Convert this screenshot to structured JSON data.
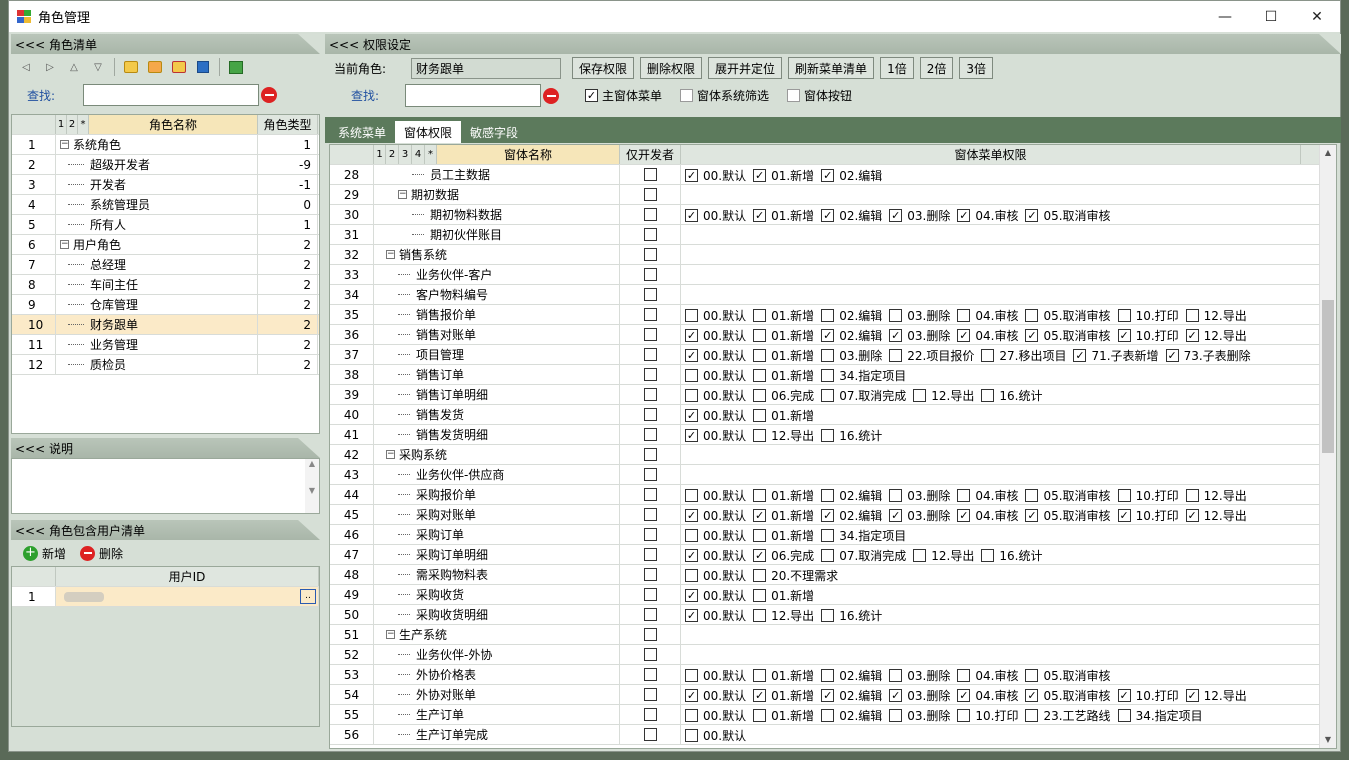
{
  "title": "角色管理",
  "window_buttons": {
    "min": "—",
    "max": "☐",
    "close": "✕"
  },
  "left": {
    "roles_header": "<<< 角色清单",
    "search_label": "查找:",
    "role_cols": {
      "c1": "1",
      "c2": "2",
      "c3": "*",
      "name": "角色名称",
      "type": "角色类型"
    },
    "roles": [
      {
        "no": "1",
        "name": "系统角色",
        "type": "1",
        "level": 0
      },
      {
        "no": "2",
        "name": "超级开发者",
        "type": "-9",
        "level": 1
      },
      {
        "no": "3",
        "name": "开发者",
        "type": "-1",
        "level": 1
      },
      {
        "no": "4",
        "name": "系统管理员",
        "type": "0",
        "level": 1
      },
      {
        "no": "5",
        "name": "所有人",
        "type": "1",
        "level": 1
      },
      {
        "no": "6",
        "name": "用户角色",
        "type": "2",
        "level": 0
      },
      {
        "no": "7",
        "name": "总经理",
        "type": "2",
        "level": 1
      },
      {
        "no": "8",
        "name": "车间主任",
        "type": "2",
        "level": 1
      },
      {
        "no": "9",
        "name": "仓库管理",
        "type": "2",
        "level": 1
      },
      {
        "no": "10",
        "name": "财务跟单",
        "type": "2",
        "level": 1,
        "selected": true
      },
      {
        "no": "11",
        "name": "业务管理",
        "type": "2",
        "level": 1
      },
      {
        "no": "12",
        "name": "质检员",
        "type": "2",
        "level": 1
      }
    ],
    "desc_header": "<<< 说明",
    "users_header": "<<< 角色包含用户清单",
    "add_label": "新增",
    "del_label": "删除",
    "user_col": "用户ID",
    "user_rows": [
      {
        "no": "1",
        "dots": ".."
      }
    ]
  },
  "right": {
    "header": "<<< 权限设定",
    "current_role_label": "当前角色:",
    "current_role": "财务跟单",
    "buttons": [
      "保存权限",
      "删除权限",
      "展开并定位",
      "刷新菜单清单",
      "1倍",
      "2倍",
      "3倍"
    ],
    "search_label": "查找:",
    "opts": [
      {
        "label": "主窗体菜单",
        "checked": true
      },
      {
        "label": "窗体系统筛选",
        "checked": false
      },
      {
        "label": "窗体按钮",
        "checked": false
      }
    ],
    "tabs": [
      "系统菜单",
      "窗体权限",
      "敏感字段"
    ],
    "active_tab": 1,
    "cols": {
      "c1": "1",
      "c2": "2",
      "c3": "3",
      "c4": "4",
      "c5": "*",
      "name": "窗体名称",
      "dev": "仅开发者",
      "perm": "窗体菜单权限"
    },
    "rows": [
      {
        "no": "28",
        "name": "员工主数据",
        "indent": 3,
        "perms": [
          [
            "00.默认",
            1
          ],
          [
            "01.新增",
            1
          ],
          [
            "02.编辑",
            1
          ]
        ]
      },
      {
        "no": "29",
        "name": "期初数据",
        "indent": 2,
        "group": true,
        "perms": []
      },
      {
        "no": "30",
        "name": "期初物料数据",
        "indent": 3,
        "perms": [
          [
            "00.默认",
            1
          ],
          [
            "01.新增",
            1
          ],
          [
            "02.编辑",
            1
          ],
          [
            "03.删除",
            1
          ],
          [
            "04.审核",
            1
          ],
          [
            "05.取消审核",
            1
          ]
        ]
      },
      {
        "no": "31",
        "name": "期初伙伴账目",
        "indent": 3,
        "perms": []
      },
      {
        "no": "32",
        "name": "销售系统",
        "indent": 1,
        "group": true,
        "perms": []
      },
      {
        "no": "33",
        "name": "业务伙伴-客户",
        "indent": 2,
        "perms": []
      },
      {
        "no": "34",
        "name": "客户物料编号",
        "indent": 2,
        "perms": []
      },
      {
        "no": "35",
        "name": "销售报价单",
        "indent": 2,
        "perms": [
          [
            "00.默认",
            0
          ],
          [
            "01.新增",
            0
          ],
          [
            "02.编辑",
            0
          ],
          [
            "03.删除",
            0
          ],
          [
            "04.审核",
            0
          ],
          [
            "05.取消审核",
            0
          ],
          [
            "10.打印",
            0
          ],
          [
            "12.导出",
            0
          ]
        ]
      },
      {
        "no": "36",
        "name": "销售对账单",
        "indent": 2,
        "perms": [
          [
            "00.默认",
            1
          ],
          [
            "01.新增",
            0
          ],
          [
            "02.编辑",
            1
          ],
          [
            "03.删除",
            1
          ],
          [
            "04.审核",
            1
          ],
          [
            "05.取消审核",
            1
          ],
          [
            "10.打印",
            1
          ],
          [
            "12.导出",
            1
          ]
        ]
      },
      {
        "no": "37",
        "name": "项目管理",
        "indent": 2,
        "perms": [
          [
            "00.默认",
            1
          ],
          [
            "01.新增",
            0
          ],
          [
            "03.删除",
            0
          ],
          [
            "22.项目报价",
            0
          ],
          [
            "27.移出项目",
            0
          ],
          [
            "71.子表新增",
            1
          ],
          [
            "73.子表删除",
            1
          ]
        ]
      },
      {
        "no": "38",
        "name": "销售订单",
        "indent": 2,
        "perms": [
          [
            "00.默认",
            0
          ],
          [
            "01.新增",
            0
          ],
          [
            "34.指定项目",
            0
          ]
        ]
      },
      {
        "no": "39",
        "name": "销售订单明细",
        "indent": 2,
        "perms": [
          [
            "00.默认",
            0
          ],
          [
            "06.完成",
            0
          ],
          [
            "07.取消完成",
            0
          ],
          [
            "12.导出",
            0
          ],
          [
            "16.统计",
            0
          ]
        ]
      },
      {
        "no": "40",
        "name": "销售发货",
        "indent": 2,
        "perms": [
          [
            "00.默认",
            1
          ],
          [
            "01.新增",
            0
          ]
        ]
      },
      {
        "no": "41",
        "name": "销售发货明细",
        "indent": 2,
        "perms": [
          [
            "00.默认",
            1
          ],
          [
            "12.导出",
            0
          ],
          [
            "16.统计",
            0
          ]
        ]
      },
      {
        "no": "42",
        "name": "采购系统",
        "indent": 1,
        "group": true,
        "perms": []
      },
      {
        "no": "43",
        "name": "业务伙伴-供应商",
        "indent": 2,
        "perms": []
      },
      {
        "no": "44",
        "name": "采购报价单",
        "indent": 2,
        "perms": [
          [
            "00.默认",
            0
          ],
          [
            "01.新增",
            0
          ],
          [
            "02.编辑",
            0
          ],
          [
            "03.删除",
            0
          ],
          [
            "04.审核",
            0
          ],
          [
            "05.取消审核",
            0
          ],
          [
            "10.打印",
            0
          ],
          [
            "12.导出",
            0
          ]
        ]
      },
      {
        "no": "45",
        "name": "采购对账单",
        "indent": 2,
        "perms": [
          [
            "00.默认",
            1
          ],
          [
            "01.新增",
            1
          ],
          [
            "02.编辑",
            1
          ],
          [
            "03.删除",
            1
          ],
          [
            "04.审核",
            1
          ],
          [
            "05.取消审核",
            1
          ],
          [
            "10.打印",
            1
          ],
          [
            "12.导出",
            1
          ]
        ]
      },
      {
        "no": "46",
        "name": "采购订单",
        "indent": 2,
        "perms": [
          [
            "00.默认",
            0
          ],
          [
            "01.新增",
            0
          ],
          [
            "34.指定项目",
            0
          ]
        ]
      },
      {
        "no": "47",
        "name": "采购订单明细",
        "indent": 2,
        "perms": [
          [
            "00.默认",
            1
          ],
          [
            "06.完成",
            1
          ],
          [
            "07.取消完成",
            0
          ],
          [
            "12.导出",
            0
          ],
          [
            "16.统计",
            0
          ]
        ]
      },
      {
        "no": "48",
        "name": "需采购物料表",
        "indent": 2,
        "perms": [
          [
            "00.默认",
            0
          ],
          [
            "20.不理需求",
            0
          ]
        ]
      },
      {
        "no": "49",
        "name": "采购收货",
        "indent": 2,
        "perms": [
          [
            "00.默认",
            1
          ],
          [
            "01.新增",
            0
          ]
        ]
      },
      {
        "no": "50",
        "name": "采购收货明细",
        "indent": 2,
        "perms": [
          [
            "00.默认",
            1
          ],
          [
            "12.导出",
            0
          ],
          [
            "16.统计",
            0
          ]
        ]
      },
      {
        "no": "51",
        "name": "生产系统",
        "indent": 1,
        "group": true,
        "perms": []
      },
      {
        "no": "52",
        "name": "业务伙伴-外协",
        "indent": 2,
        "perms": []
      },
      {
        "no": "53",
        "name": "外协价格表",
        "indent": 2,
        "perms": [
          [
            "00.默认",
            0
          ],
          [
            "01.新增",
            0
          ],
          [
            "02.编辑",
            0
          ],
          [
            "03.删除",
            0
          ],
          [
            "04.审核",
            0
          ],
          [
            "05.取消审核",
            0
          ]
        ]
      },
      {
        "no": "54",
        "name": "外协对账单",
        "indent": 2,
        "perms": [
          [
            "00.默认",
            1
          ],
          [
            "01.新增",
            1
          ],
          [
            "02.编辑",
            1
          ],
          [
            "03.删除",
            1
          ],
          [
            "04.审核",
            1
          ],
          [
            "05.取消审核",
            1
          ],
          [
            "10.打印",
            1
          ],
          [
            "12.导出",
            1
          ]
        ]
      },
      {
        "no": "55",
        "name": "生产订单",
        "indent": 2,
        "perms": [
          [
            "00.默认",
            0
          ],
          [
            "01.新增",
            0
          ],
          [
            "02.编辑",
            0
          ],
          [
            "03.删除",
            0
          ],
          [
            "10.打印",
            0
          ],
          [
            "23.工艺路线",
            0
          ],
          [
            "34.指定项目",
            0
          ]
        ]
      },
      {
        "no": "56",
        "name": "生产订单完成",
        "indent": 2,
        "perms": [
          [
            "00.默认",
            0
          ]
        ]
      }
    ]
  },
  "icons": {
    "check": "✓",
    "minus_box": "⊟",
    "scroll_up": "▲",
    "scroll_down": "▼"
  },
  "colors": {
    "tab_bar": "#5c7a5c",
    "selected_row": "#fbeac8",
    "header_bg": "#f6e6b9"
  }
}
